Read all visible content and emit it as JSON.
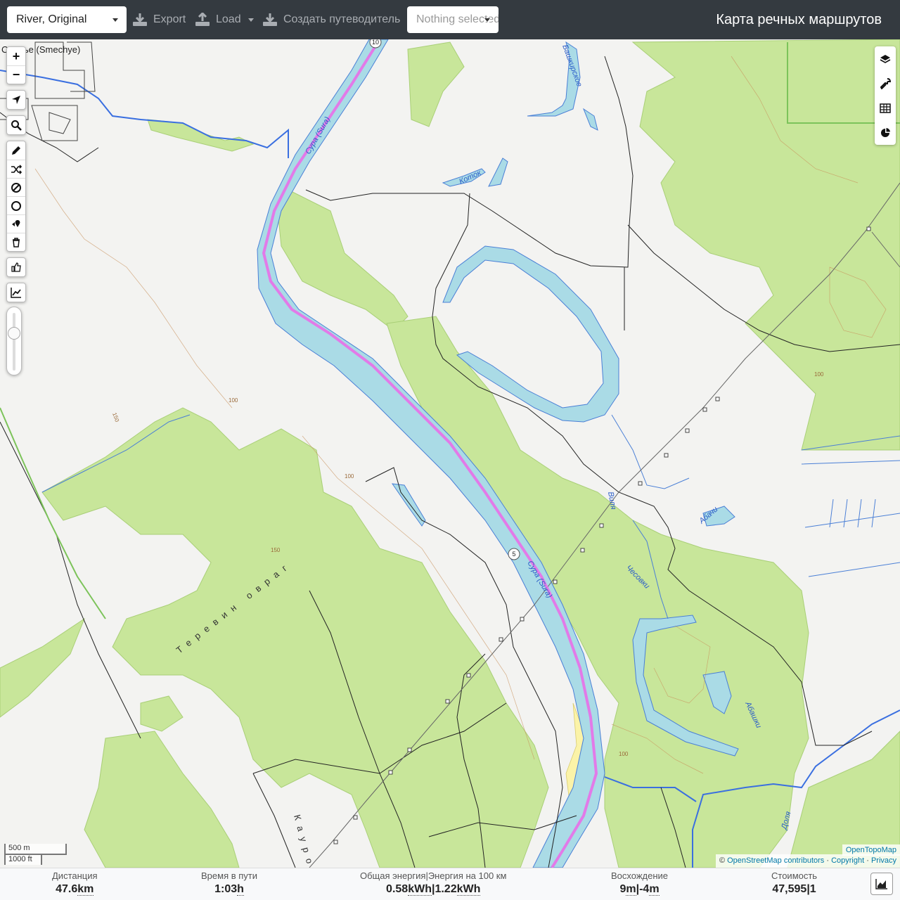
{
  "toolbar": {
    "profile_select": "River, Original",
    "export_label": "Export",
    "load_label": "Load",
    "guide_label": "Создать путеводитель",
    "nothing_select": "Nothing selected",
    "title": "Карта речных маршрутов"
  },
  "map_controls": {
    "zoom_in": "+",
    "zoom_out": "−"
  },
  "map_labels": {
    "sura_north": "Сура (Sura)",
    "sura_mid": "Сура (Sura)",
    "route_marker_top": "10",
    "route_marker_mid": "5",
    "kotok": "Коток",
    "bashkirskoe": "Башкирское",
    "terevin_ovrag": "Теревин овраг",
    "kaurov": "Кауров",
    "vilya": "Виля",
    "abachi": "Абачи",
    "chesovki": "Чесовки",
    "abashki": "Абашки",
    "dolya": "Доля",
    "town_name": "Смечье (Smechye)",
    "contour_100": "100",
    "contour_150": "150"
  },
  "scale": {
    "metric": "500 m",
    "imperial": "1000 ft"
  },
  "attribution": {
    "opentopomap": "OpenTopoMap",
    "copy_prefix": "©",
    "osm": "OpenStreetMap contributors",
    "copyright": "Copyright",
    "privacy": "Privacy"
  },
  "stats": {
    "distance_label": "Дистанция",
    "distance_value": "47.6",
    "distance_unit": "km",
    "time_label": "Время в пути",
    "time_value": "1:03",
    "time_unit": "h",
    "energy_label": "Общая энергия|Энергия на 100 км",
    "energy_total": "0.58",
    "energy_total_unit": "kWh",
    "energy_per100": "1.22",
    "energy_per100_unit": "kWh",
    "ascend_label": "Восхождение",
    "ascend_up": "9",
    "ascend_down": "-4",
    "ascend_unit": "m",
    "cost_label": "Стоимость",
    "cost_value": "47,595",
    "cost_extra": "1"
  },
  "colors": {
    "topbar": "#343a40",
    "forest": "#c8e69a",
    "water": "#aadbe6",
    "water_edge": "#4a7fd6",
    "route": "#e27ae8",
    "sand": "#fbf3a8"
  },
  "icons": [
    "export-icon",
    "load-icon",
    "guide-icon",
    "locate-icon",
    "search-icon",
    "draw-icon",
    "shuffle-icon",
    "no-go-icon",
    "circle-icon",
    "poi-icon",
    "trash-icon",
    "like-icon",
    "chart-icon",
    "layers-icon",
    "wrench-icon",
    "table-icon",
    "pie-icon"
  ]
}
